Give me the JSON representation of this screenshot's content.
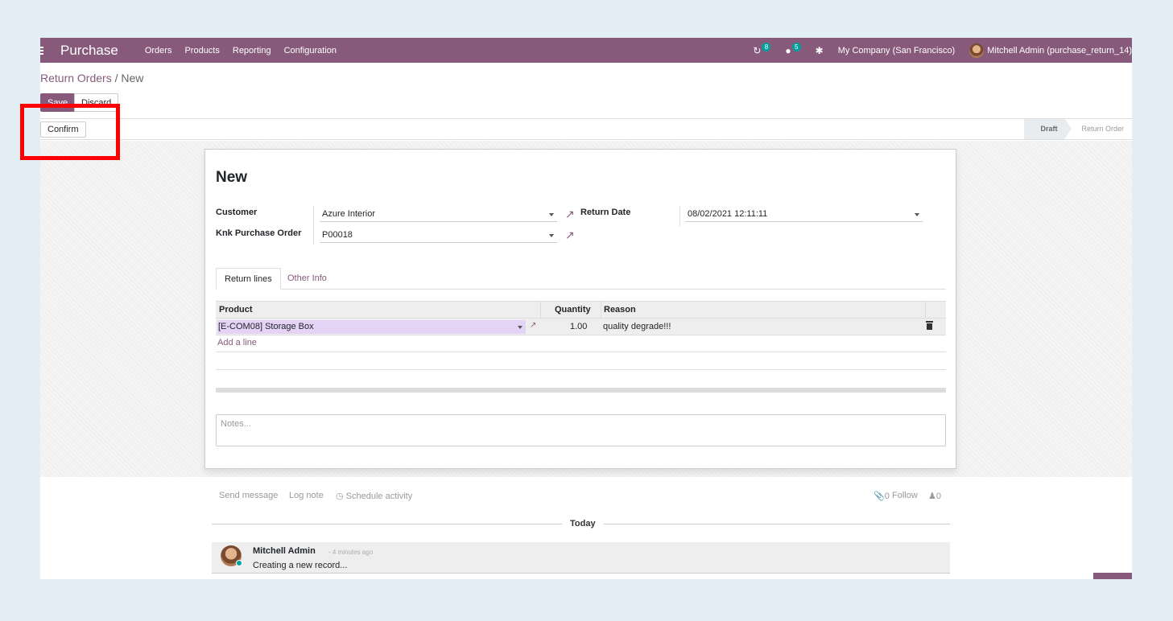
{
  "navbar": {
    "brand": "Purchase",
    "menu": [
      "Orders",
      "Products",
      "Reporting",
      "Configuration"
    ],
    "activity_count": "8",
    "message_count": "5",
    "company": "My Company (San Francisco)",
    "user": "Mitchell Admin (purchase_return_14)"
  },
  "breadcrumb": {
    "parent": "Return Orders",
    "separator": " / ",
    "current": "New"
  },
  "buttons": {
    "save": "Save",
    "discard": "Discard",
    "confirm": "Confirm"
  },
  "status": {
    "stages": [
      "Draft",
      "Return Order"
    ],
    "active": "Draft"
  },
  "form": {
    "title": "New",
    "customer_label": "Customer",
    "customer_value": "Azure Interior",
    "purchase_order_label": "Knk Purchase Order",
    "purchase_order_value": "P00018",
    "return_date_label": "Return Date",
    "return_date_value": "08/02/2021 12:11:11",
    "tabs": [
      "Return lines",
      "Other Info"
    ],
    "columns": {
      "product": "Product",
      "quantity": "Quantity",
      "reason": "Reason"
    },
    "lines": [
      {
        "product": "[E-COM08] Storage Box",
        "quantity": "1.00",
        "reason": "quality degrade!!!"
      }
    ],
    "add_line": "Add a line",
    "notes_placeholder": "Notes..."
  },
  "chatter": {
    "send_message": "Send message",
    "log_note": "Log note",
    "schedule_activity": "Schedule activity",
    "attachments_count": "0",
    "follow": "Follow",
    "followers_count": "0",
    "date_separator": "Today",
    "messages": [
      {
        "author": "Mitchell Admin",
        "time": "- 4 minutes ago",
        "body": "Creating a new record..."
      }
    ]
  },
  "colors": {
    "brand": "#875a7b",
    "badge": "#00a09d",
    "highlight": "#ff0000"
  }
}
